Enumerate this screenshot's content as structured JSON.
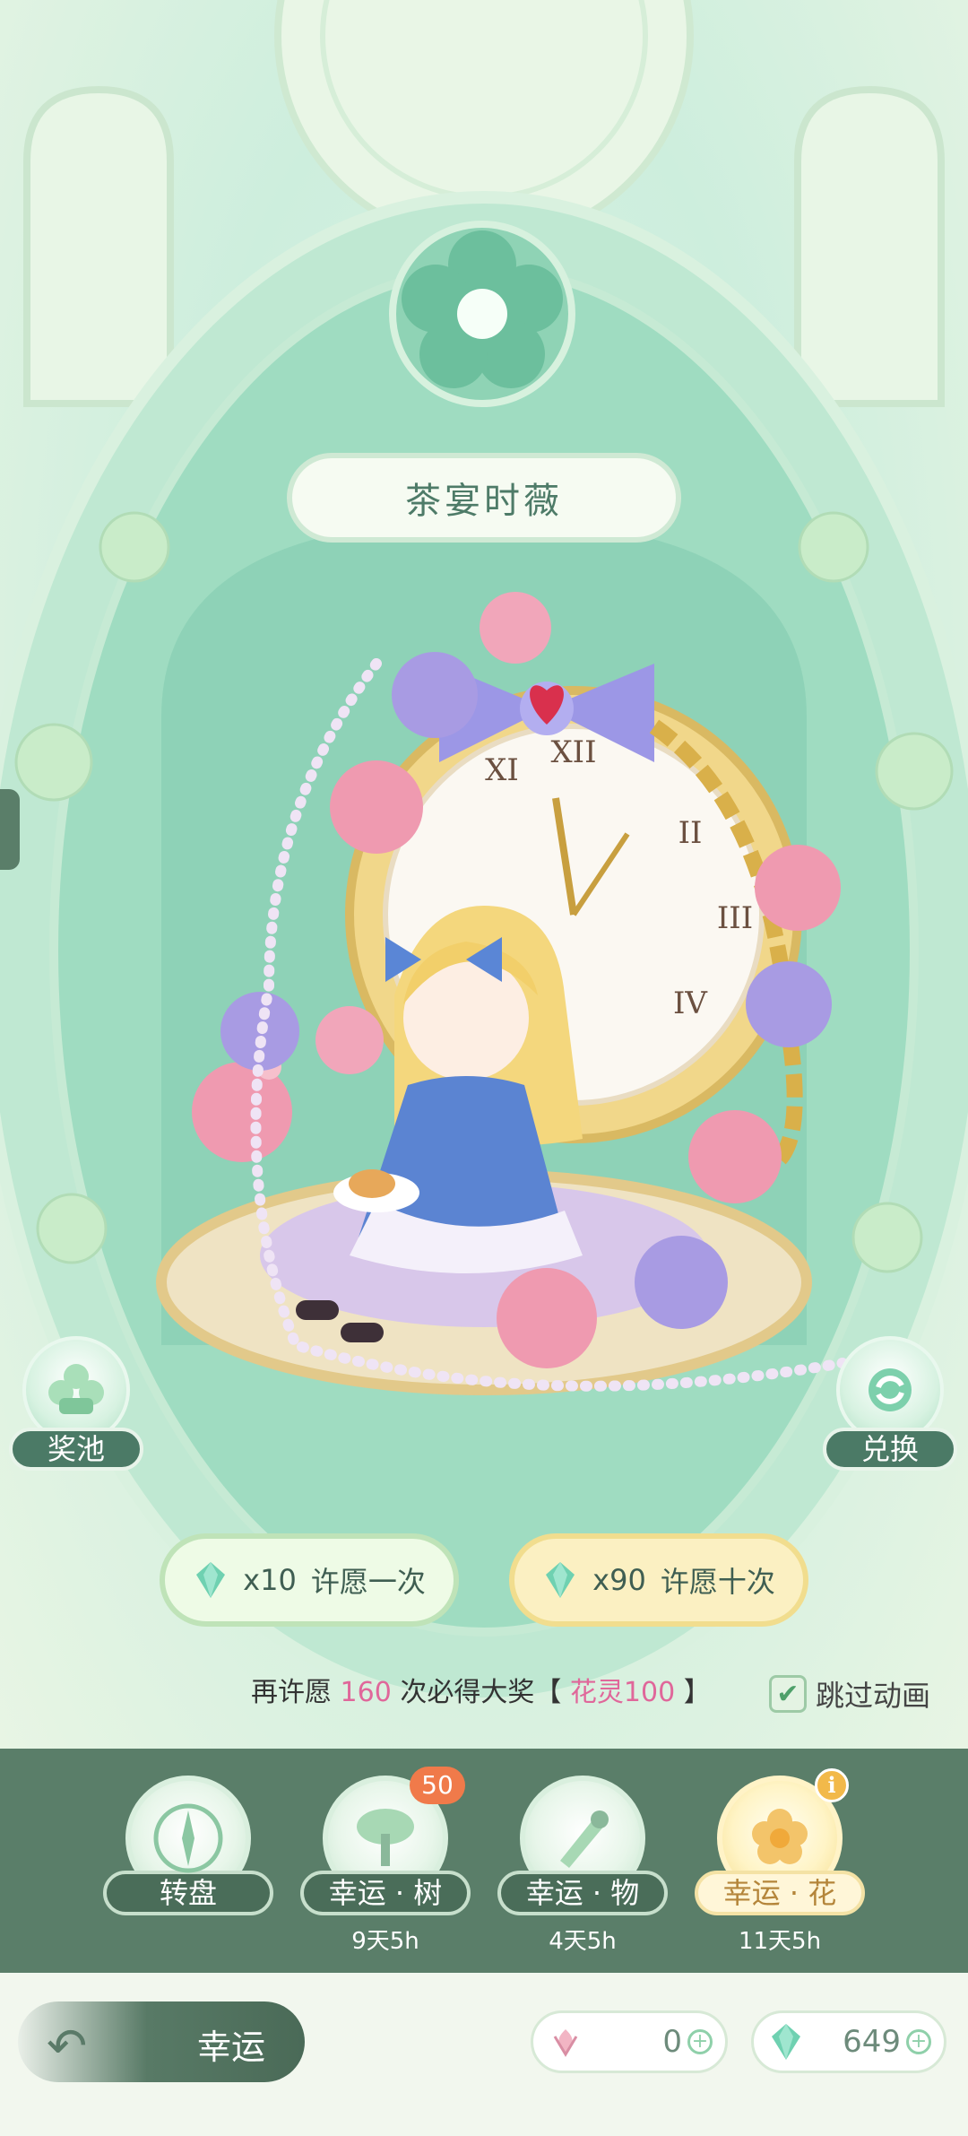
{
  "banner": {
    "title": "茶宴时薇"
  },
  "side": {
    "pool_label": "奖池",
    "exchange_label": "兑换"
  },
  "wish": {
    "single": {
      "cost": "x10",
      "label": "许愿一次"
    },
    "ten": {
      "cost": "x90",
      "label": "许愿十次"
    }
  },
  "pity": {
    "prefix": "再许愿",
    "count": "160",
    "middle": "次必得大奖【",
    "reward": "花灵100",
    "suffix": "】"
  },
  "skip": {
    "label": "跳过动画",
    "checked": true
  },
  "tabs": [
    {
      "label": "转盘",
      "timer": "",
      "badge": ""
    },
    {
      "label": "幸运 · 树",
      "timer": "9天5h",
      "badge": "50"
    },
    {
      "label": "幸运 · 物",
      "timer": "4天5h",
      "badge": ""
    },
    {
      "label": "幸运 · 花",
      "timer": "11天5h",
      "badge": "",
      "active": true
    }
  ],
  "footer": {
    "back_label": "幸运"
  },
  "currencies": [
    {
      "icon": "flower-token-icon",
      "value": "0"
    },
    {
      "icon": "gem-icon",
      "value": "649"
    }
  ],
  "colors": {
    "mint": "#cdeedd",
    "tabbar": "#5a7e69",
    "accent_pink": "#e0679a",
    "gold": "#f1dd8e"
  }
}
